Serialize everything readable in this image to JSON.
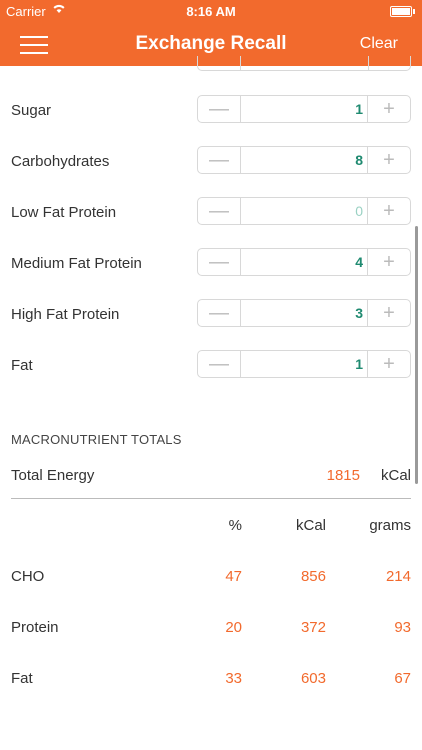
{
  "status": {
    "carrier": "Carrier",
    "wifi_icon": "wifi-icon",
    "time": "8:16 AM",
    "battery_icon": "battery-icon"
  },
  "nav": {
    "title": "Exchange Recall",
    "clear_label": "Clear",
    "menu_icon": "hamburger-menu-icon",
    "color": "#f26a2d"
  },
  "exchanges": [
    {
      "label": "Sugar",
      "value": "1"
    },
    {
      "label": "Carbohydrates",
      "value": "8"
    },
    {
      "label": "Low Fat Protein",
      "value": "0"
    },
    {
      "label": "Medium Fat Protein",
      "value": "4"
    },
    {
      "label": "High Fat Protein",
      "value": "3"
    },
    {
      "label": "Fat",
      "value": "1"
    }
  ],
  "stepper": {
    "minus": "—",
    "plus": "+"
  },
  "totals": {
    "header": "MACRONUTRIENT TOTALS",
    "energy_label": "Total Energy",
    "energy_value": "1815",
    "energy_unit": "kCal",
    "columns": {
      "pct": "%",
      "kcal": "kCal",
      "grams": "grams"
    },
    "rows": [
      {
        "label": "CHO",
        "pct": "47",
        "kcal": "856",
        "grams": "214"
      },
      {
        "label": "Protein",
        "pct": "20",
        "kcal": "372",
        "grams": "93"
      },
      {
        "label": "Fat",
        "pct": "33",
        "kcal": "603",
        "grams": "67"
      }
    ]
  },
  "colors": {
    "accent": "#f26a2d",
    "value_green": "#1f8a70"
  }
}
